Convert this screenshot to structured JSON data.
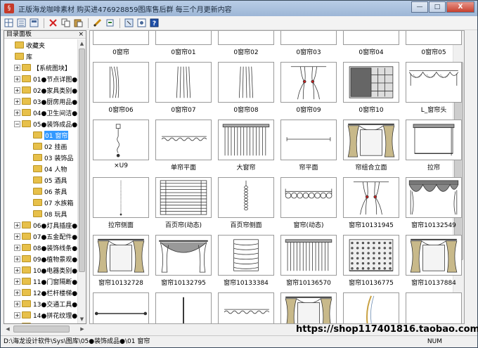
{
  "window": {
    "title": "正版海龙咖啡素材 购买进476928859图库售后群 每三个月更新内容",
    "minimize_label": "—",
    "maximize_label": "□",
    "close_label": "X"
  },
  "toolbar": {
    "icons": [
      "grid-view-icon",
      "detail-view-icon",
      "list-view-icon",
      "delete-icon",
      "copy-icon",
      "paste-icon",
      "draw-icon",
      "settings-icon",
      "import-icon",
      "export-icon",
      "help-icon"
    ]
  },
  "sidebar": {
    "title": "目录面板",
    "close": "×",
    "items": [
      {
        "label": "收藏夹",
        "level": 1,
        "expander": ""
      },
      {
        "label": "库",
        "level": 1,
        "expander": ""
      },
      {
        "label": "【系统图块】",
        "level": 2,
        "expander": "+"
      },
      {
        "label": "01●节点详图●",
        "level": 2,
        "expander": "+"
      },
      {
        "label": "02●家具类别●",
        "level": 2,
        "expander": "+"
      },
      {
        "label": "03●厨房用品●",
        "level": 2,
        "expander": "+"
      },
      {
        "label": "04●卫生间洁●",
        "level": 2,
        "expander": "+"
      },
      {
        "label": "05●装饰成品●",
        "level": 2,
        "expander": "−"
      },
      {
        "label": "01 窗帘",
        "level": 3,
        "expander": "",
        "selected": true
      },
      {
        "label": "02 挂画",
        "level": 3,
        "expander": ""
      },
      {
        "label": "03 装饰品",
        "level": 3,
        "expander": ""
      },
      {
        "label": "04 人物",
        "level": 3,
        "expander": ""
      },
      {
        "label": "05 酒具",
        "level": 3,
        "expander": ""
      },
      {
        "label": "06 茶具",
        "level": 3,
        "expander": ""
      },
      {
        "label": "07 水族箱",
        "level": 3,
        "expander": ""
      },
      {
        "label": "08 玩具",
        "level": 3,
        "expander": ""
      },
      {
        "label": "06●灯具插座●",
        "level": 2,
        "expander": "+"
      },
      {
        "label": "07●五金配件●",
        "level": 2,
        "expander": "+"
      },
      {
        "label": "08●装饰线条●",
        "level": 2,
        "expander": "+"
      },
      {
        "label": "09●植物景观●",
        "level": 2,
        "expander": "+"
      },
      {
        "label": "10●电器类别●",
        "level": 2,
        "expander": "+"
      },
      {
        "label": "11●门窗隔断●",
        "level": 2,
        "expander": "+"
      },
      {
        "label": "12●栏杆楼梯●",
        "level": 2,
        "expander": "+"
      },
      {
        "label": "13●交通工具●",
        "level": 2,
        "expander": "+"
      },
      {
        "label": "14●拼花纹理●",
        "level": 2,
        "expander": "+"
      },
      {
        "label": "15●娱乐健身●",
        "level": 2,
        "expander": "+"
      },
      {
        "label": "16●动态图块●",
        "level": 2,
        "expander": "+"
      }
    ]
  },
  "grid": {
    "items": [
      {
        "label": "0窗帘",
        "kind": "none"
      },
      {
        "label": "0窗帘01",
        "kind": "none"
      },
      {
        "label": "0窗帘02",
        "kind": "none"
      },
      {
        "label": "0窗帘03",
        "kind": "none"
      },
      {
        "label": "0窗帘04",
        "kind": "none"
      },
      {
        "label": "0窗帘05",
        "kind": "none"
      },
      {
        "label": "0窗帘06",
        "kind": "side-curtain"
      },
      {
        "label": "0窗帘07",
        "kind": "lines"
      },
      {
        "label": "0窗帘08",
        "kind": "lines"
      },
      {
        "label": "0窗帘09",
        "kind": "tied-curtain"
      },
      {
        "label": "0窗帘10",
        "kind": "rack"
      },
      {
        "label": "L_窗帘头",
        "kind": "valance"
      },
      {
        "label": "×U9",
        "kind": "pull-cord"
      },
      {
        "label": "单帘平面",
        "kind": "plan-wave"
      },
      {
        "label": "大窗帘",
        "kind": "full-curtain"
      },
      {
        "label": "帘平面",
        "kind": "plan-line"
      },
      {
        "label": "帘组合立面",
        "kind": "drape-set"
      },
      {
        "label": "拉帘",
        "kind": "roller"
      },
      {
        "label": "拉帘侧面",
        "kind": "side-line"
      },
      {
        "label": "百页帘(动态)",
        "kind": "blinds"
      },
      {
        "label": "百页帘侧面",
        "kind": "chain"
      },
      {
        "label": "窗帘(动态)",
        "kind": "loops"
      },
      {
        "label": "窗帘10131945",
        "kind": "tied-curtain"
      },
      {
        "label": "窗帘10132549",
        "kind": "festoon"
      },
      {
        "label": "窗帘10132728",
        "kind": "drape-set"
      },
      {
        "label": "窗帘10132795",
        "kind": "swag"
      },
      {
        "label": "窗帘10133384",
        "kind": "roman"
      },
      {
        "label": "窗帘10136570",
        "kind": "full-curtain"
      },
      {
        "label": "窗帘10136775",
        "kind": "lace"
      },
      {
        "label": "窗帘10137884",
        "kind": "drape-set"
      },
      {
        "label": "",
        "kind": "rod"
      },
      {
        "label": "",
        "kind": "single-rod"
      },
      {
        "label": "",
        "kind": "plan-wave"
      },
      {
        "label": "",
        "kind": "drape-set"
      },
      {
        "label": "",
        "kind": "sheer"
      },
      {
        "label": "",
        "kind": "none"
      }
    ]
  },
  "status": {
    "path": "D:\\海龙设计软件\\Sys\\图库\\05●装饰成品●\\01 窗帘",
    "num": "NUM"
  },
  "watermark": "https://shop117401816.taobao.com"
}
